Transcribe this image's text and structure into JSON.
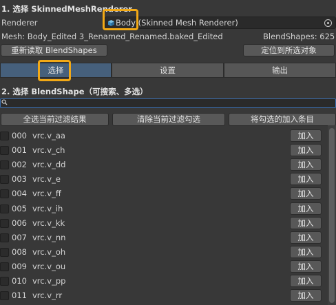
{
  "section1_title": "1. 选择 SkinnedMeshRenderer",
  "renderer": {
    "label": "Renderer",
    "object_name": "Body",
    "object_type": " (Skinned Mesh Renderer)",
    "icon": "skinned-mesh-cube-icon"
  },
  "mesh_info": "Mesh: Body_Edited 3_Renamed_Renamed.baked_Edited",
  "blendshape_count": "BlendShapes: 625",
  "buttons": {
    "reload": "重新读取 BlendShapes",
    "locate": "定位到所选对象",
    "select_all": "全选当前过滤结果",
    "clear": "清除当前过滤勾选",
    "add_checked": "将勾选的加入条目"
  },
  "tabs": [
    "选择",
    "设置",
    "输出"
  ],
  "active_tab": "选择",
  "section2_title": "2. 选择 BlendShape（可搜索、多选）",
  "search": {
    "value": "",
    "icon": "search-icon"
  },
  "add_label": "加入",
  "blendshapes": [
    {
      "index": "000",
      "name": "vrc.v_aa",
      "checked": false
    },
    {
      "index": "001",
      "name": "vrc.v_ch",
      "checked": false
    },
    {
      "index": "002",
      "name": "vrc.v_dd",
      "checked": false
    },
    {
      "index": "003",
      "name": "vrc.v_e",
      "checked": false
    },
    {
      "index": "004",
      "name": "vrc.v_ff",
      "checked": false
    },
    {
      "index": "005",
      "name": "vrc.v_ih",
      "checked": false
    },
    {
      "index": "006",
      "name": "vrc.v_kk",
      "checked": false
    },
    {
      "index": "007",
      "name": "vrc.v_nn",
      "checked": false
    },
    {
      "index": "008",
      "name": "vrc.v_oh",
      "checked": false
    },
    {
      "index": "009",
      "name": "vrc.v_ou",
      "checked": false
    },
    {
      "index": "010",
      "name": "vrc.v_pp",
      "checked": false
    },
    {
      "index": "011",
      "name": "vrc.v_rr",
      "checked": false
    }
  ],
  "colors": {
    "background": "#383838",
    "active_tab": "#46607c",
    "highlight": "#f2a916",
    "search_focus": "#3b6fb0"
  }
}
